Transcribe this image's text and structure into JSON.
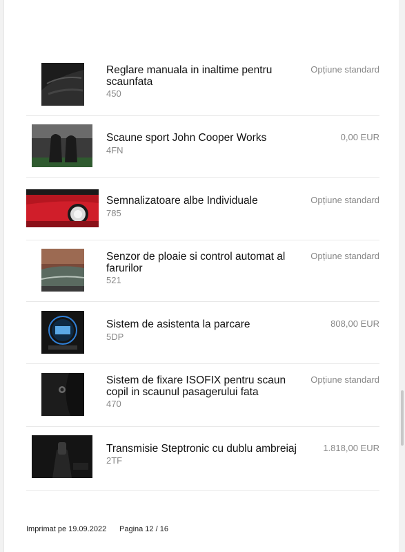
{
  "options": [
    {
      "title": "Reglare manuala in inaltime pentru scaunfata",
      "code": "450",
      "price": "Opțiune standard",
      "image": "seat-height-adjust-photo"
    },
    {
      "title": "Scaune sport John Cooper Works",
      "code": "4FN",
      "price": "0,00 EUR",
      "image": "sport-seats-photo"
    },
    {
      "title": "Semnalizatoare albe Individuale",
      "code": "785",
      "price": "Opțiune standard",
      "image": "white-indicators-photo"
    },
    {
      "title": "Senzor de ploaie si control automat al farurilor",
      "code": "521",
      "price": "Opțiune standard",
      "image": "rain-sensor-photo"
    },
    {
      "title": "Sistem de asistenta la parcare",
      "code": "5DP",
      "price": "808,00 EUR",
      "image": "parking-assist-photo"
    },
    {
      "title": "Sistem de fixare ISOFIX pentru scaun copil in scaunul pasagerului fata",
      "code": "470",
      "price": "Opțiune standard",
      "image": "isofix-photo"
    },
    {
      "title": "Transmisie Steptronic cu dublu ambreiaj",
      "code": "2TF",
      "price": "1.818,00 EUR",
      "image": "steptronic-photo"
    }
  ],
  "footer": {
    "printed": "Imprimat pe 19.09.2022",
    "page": "Pagina 12 / 16"
  },
  "colors": {
    "text": "#111111",
    "muted": "#888888",
    "divider": "#e8e8e8",
    "car_red": "#d01e2a"
  }
}
